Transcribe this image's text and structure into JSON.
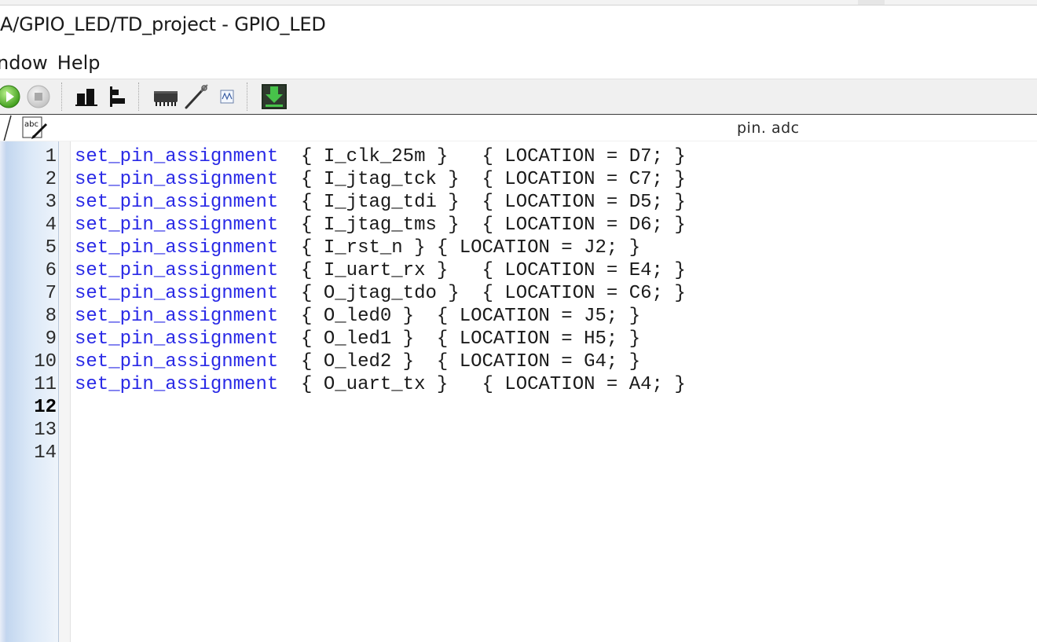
{
  "window": {
    "title": "A/GPIO_LED/TD_project - GPIO_LED"
  },
  "menu": {
    "items": [
      "ndow",
      "Help"
    ]
  },
  "toolbar": {
    "buttons": [
      {
        "name": "run-icon"
      },
      {
        "name": "stop-icon"
      },
      {
        "name": "bar-chart-icon"
      },
      {
        "name": "align-left-icon"
      },
      {
        "name": "chip-icon"
      },
      {
        "name": "probe-icon"
      },
      {
        "name": "waveform-icon"
      },
      {
        "name": "download-icon"
      }
    ]
  },
  "tab": {
    "title": "pin. adc",
    "icon": "edit-text-icon",
    "icon_label": "abc"
  },
  "editor": {
    "current_line": 12,
    "keyword_color": "#2929e6",
    "lines": [
      {
        "n": "1",
        "kw": "set_pin_assignment",
        "rest": "  { I_clk_25m }   { LOCATION = D7; }"
      },
      {
        "n": "2",
        "kw": "set_pin_assignment",
        "rest": "  { I_jtag_tck }  { LOCATION = C7; }"
      },
      {
        "n": "3",
        "kw": "set_pin_assignment",
        "rest": "  { I_jtag_tdi }  { LOCATION = D5; }"
      },
      {
        "n": "4",
        "kw": "set_pin_assignment",
        "rest": "  { I_jtag_tms }  { LOCATION = D6; }"
      },
      {
        "n": "5",
        "kw": "set_pin_assignment",
        "rest": "  { I_rst_n } { LOCATION = J2; }"
      },
      {
        "n": "6",
        "kw": "set_pin_assignment",
        "rest": "  { I_uart_rx }   { LOCATION = E4; }"
      },
      {
        "n": "7",
        "kw": "set_pin_assignment",
        "rest": "  { O_jtag_tdo }  { LOCATION = C6; }"
      },
      {
        "n": "8",
        "kw": "set_pin_assignment",
        "rest": "  { O_led0 }  { LOCATION = J5; }"
      },
      {
        "n": "9",
        "kw": "set_pin_assignment",
        "rest": "  { O_led1 }  { LOCATION = H5; }"
      },
      {
        "n": "10",
        "kw": "set_pin_assignment",
        "rest": "  { O_led2 }  { LOCATION = G4; }"
      },
      {
        "n": "11",
        "kw": "set_pin_assignment",
        "rest": "  { O_uart_tx }   { LOCATION = A4; }"
      },
      {
        "n": "12",
        "kw": "",
        "rest": ""
      },
      {
        "n": "13",
        "kw": "",
        "rest": ""
      },
      {
        "n": "14",
        "kw": "",
        "rest": ""
      }
    ]
  }
}
